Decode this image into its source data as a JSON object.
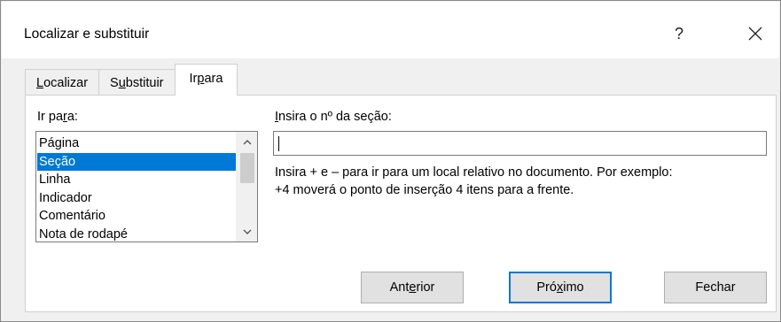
{
  "window": {
    "title": "Localizar e substituir",
    "help_label": "?",
    "close_icon": "close-icon"
  },
  "tabs": [
    {
      "pre": "",
      "accel": "L",
      "post": "ocalizar",
      "active": false
    },
    {
      "pre": "S",
      "accel": "u",
      "post": "bstituir",
      "active": false
    },
    {
      "pre": "Ir ",
      "accel": "p",
      "post": "ara",
      "active": true
    }
  ],
  "goto": {
    "label_pre": "Ir pa",
    "label_accel": "r",
    "label_post": "a:",
    "items": [
      "Página",
      "Seção",
      "Linha",
      "Indicador",
      "Comentário",
      "Nota de rodapé"
    ],
    "selected_index": 1
  },
  "section": {
    "label_accel": "I",
    "label_post": "nsira o nº da seção:",
    "value": "",
    "hint_line1": "Insira + e – para ir para um local relativo no documento. Por exemplo:",
    "hint_line2": "+4 moverá o ponto de inserção 4 itens para a frente."
  },
  "buttons": {
    "previous_pre": "Ant",
    "previous_accel": "e",
    "previous_post": "rior",
    "next_pre": "Pró",
    "next_accel": "x",
    "next_post": "imo",
    "close": "Fechar"
  },
  "colors": {
    "selection": "#0078d7",
    "dialog_bg": "#f0f0f0"
  }
}
